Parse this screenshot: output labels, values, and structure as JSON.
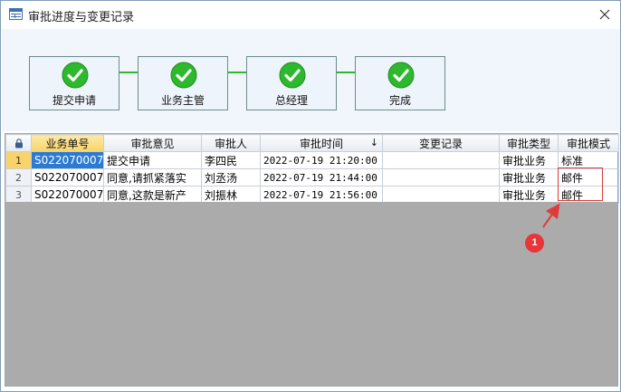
{
  "window": {
    "title": "审批进度与变更记录",
    "close_icon": "close-icon",
    "title_icon": "table-icon"
  },
  "flow": {
    "steps": [
      {
        "label": "提交申请",
        "status": "done"
      },
      {
        "label": "业务主管",
        "status": "done"
      },
      {
        "label": "总经理",
        "status": "done"
      },
      {
        "label": "完成",
        "status": "done"
      }
    ],
    "check_color": "#2eb82e"
  },
  "grid": {
    "lock_icon": "lock-icon",
    "columns": [
      "业务单号",
      "审批意见",
      "审批人",
      "审批时间",
      "变更记录",
      "审批类型",
      "审批模式"
    ],
    "sort_indicator": "↓",
    "rows": [
      {
        "num": "1",
        "cells": [
          "S022070007",
          "提交申请",
          "李四民",
          "2022-07-19 21:20:00",
          "",
          "审批业务",
          "标准"
        ]
      },
      {
        "num": "2",
        "cells": [
          "S022070007",
          "同意,请抓紧落实",
          "刘丞汤",
          "2022-07-19 21:44:00",
          "",
          "审批业务",
          "邮件"
        ]
      },
      {
        "num": "3",
        "cells": [
          "S022070007",
          "同意,这款是新产",
          "刘振林",
          "2022-07-19 21:56:00",
          "",
          "审批业务",
          "邮件"
        ]
      }
    ]
  },
  "annotation": {
    "marker": "1",
    "color": "#e03b3b"
  }
}
